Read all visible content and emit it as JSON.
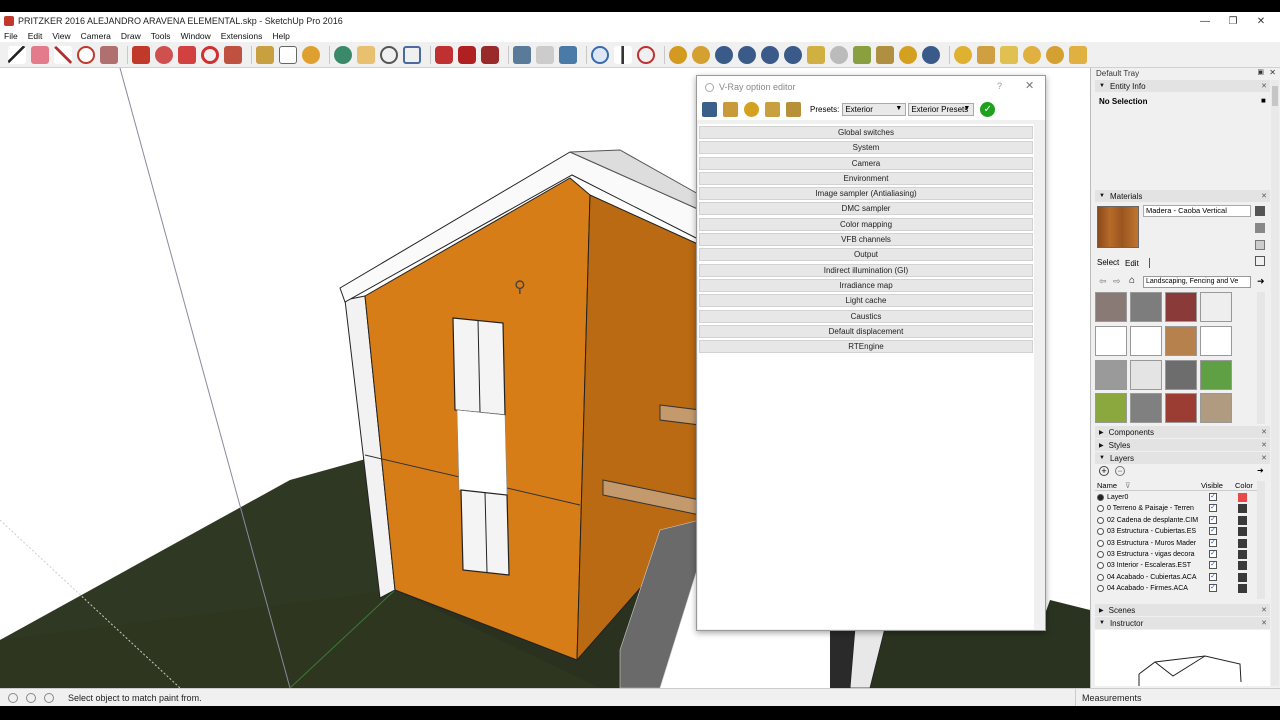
{
  "window": {
    "title": "PRITZKER 2016 ALEJANDRO ARAVENA ELEMENTAL.skp - SketchUp Pro 2016",
    "minimize": "—",
    "maximize": "❐",
    "close": "✕"
  },
  "menu": [
    "File",
    "Edit",
    "View",
    "Camera",
    "Draw",
    "Tools",
    "Window",
    "Extensions",
    "Help"
  ],
  "status": {
    "hint": "Select object to match paint from.",
    "measurements_label": "Measurements"
  },
  "vray": {
    "title": "V-Ray option editor",
    "help": "?",
    "close": "✕",
    "presets_label": "Presets:",
    "preset_value": "Exterior",
    "preset_group": "Exterior Presets",
    "rollouts": [
      "Global switches",
      "System",
      "Camera",
      "Environment",
      "Image sampler (Antialiasing)",
      "DMC sampler",
      "Color mapping",
      "VFB channels",
      "Output",
      "Indirect illumination (GI)",
      "Irradiance map",
      "Light cache",
      "Caustics",
      "Default displacement",
      "RTEngine"
    ]
  },
  "tray": {
    "title": "Default Tray",
    "entity_info": {
      "header": "Entity Info",
      "value": "No Selection"
    },
    "materials": {
      "header": "Materials",
      "current_name": "Madera - Caoba Vertical",
      "tab_select": "Select",
      "tab_edit": "Edit",
      "collection": "Landscaping, Fencing and Ve",
      "swatch_colors": [
        "#8a7a75",
        "#7d7d7d",
        "#8b3a3a",
        "#eeeeee",
        "#ffffff",
        "#ffffff",
        "#b7814e",
        "#ffffff",
        "#9a9a9a",
        "#e4e4e4",
        "#6d6d6d",
        "#5fa045",
        "#8aa83e",
        "#808080",
        "#9b3d33",
        "#b09a80"
      ]
    },
    "components": {
      "header": "Components"
    },
    "styles": {
      "header": "Styles"
    },
    "layers": {
      "header": "Layers",
      "col_name": "Name",
      "col_visible": "Visible",
      "col_color": "Color",
      "rows": [
        {
          "name": "Layer0",
          "active": true,
          "color": "#e84a4a"
        },
        {
          "name": "0 Terreno & Paisaje - Terren",
          "active": false,
          "color": "#3a3a3a"
        },
        {
          "name": "02 Cadena de desplante.CIM",
          "active": false,
          "color": "#3a3a3a"
        },
        {
          "name": "03 Estructura - Cubiertas.ES",
          "active": false,
          "color": "#3a3a3a"
        },
        {
          "name": "03 Estructura - Muros Mader",
          "active": false,
          "color": "#3a3a3a"
        },
        {
          "name": "03 Estructura - vigas decora",
          "active": false,
          "color": "#3a3a3a"
        },
        {
          "name": "03 Interior - Escaleras.EST",
          "active": false,
          "color": "#3a3a3a"
        },
        {
          "name": "04 Acabado - Cubiertas.ACA",
          "active": false,
          "color": "#3a3a3a"
        },
        {
          "name": "04 Acabado - Firmes.ACA",
          "active": false,
          "color": "#3a3a3a"
        }
      ]
    },
    "scenes": {
      "header": "Scenes"
    },
    "instructor": {
      "header": "Instructor"
    }
  }
}
